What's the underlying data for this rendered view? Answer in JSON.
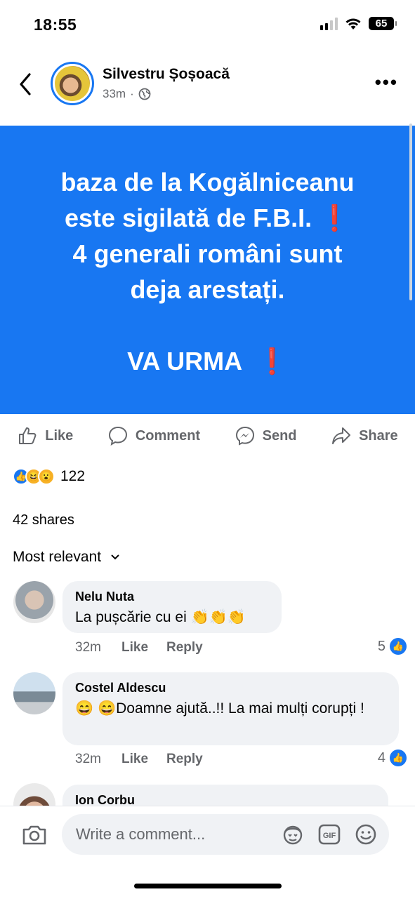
{
  "status_bar": {
    "time": "18:55",
    "battery": "65"
  },
  "header": {
    "poster_name": "Silvestru Șoșoacă",
    "post_time": "33m",
    "separator": "·"
  },
  "post": {
    "lines": [
      "baza de la Kogălniceanu",
      "este sigilată de F.B.I.",
      "4 generali români sunt",
      "deja arestați."
    ],
    "exclamation": "❗",
    "footer_line": "VA URMA",
    "background_color": "#1877f2",
    "text_color": "#ffffff"
  },
  "actions": {
    "like": "Like",
    "comment": "Comment",
    "send": "Send",
    "share": "Share"
  },
  "reactions": {
    "count": "122",
    "types": [
      "like",
      "haha",
      "wow"
    ]
  },
  "shares": "42 shares",
  "sort": {
    "label": "Most relevant"
  },
  "comments": [
    {
      "author": "Nelu Nuta",
      "text": "La pușcărie cu ei 👏👏👏",
      "time": "32m",
      "like": "Like",
      "reply": "Reply",
      "likes": "5"
    },
    {
      "author": "Costel Aldescu",
      "text": "😄 😄Doamne ajută..!! La mai mulți corupți !",
      "time": "32m",
      "like": "Like",
      "reply": "Reply",
      "likes": "4"
    },
    {
      "author": "Ion Corbu"
    }
  ],
  "composer": {
    "placeholder": "Write a comment..."
  },
  "colors": {
    "accent": "#1877f2",
    "secondary_text": "#65676b",
    "bubble": "#f0f2f5",
    "exclamation": "#e0191b"
  }
}
